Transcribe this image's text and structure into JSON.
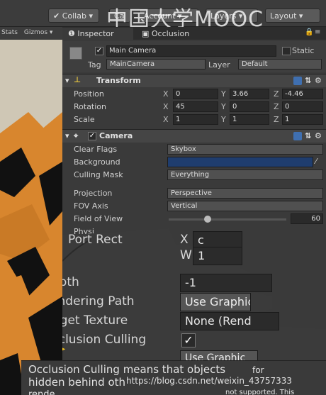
{
  "toolbar": {
    "collab": "Collab",
    "account": "Account",
    "layers": "Layers",
    "layout": "Layout",
    "cloud_label": "Ca",
    "watermark": "中国大学MOOC"
  },
  "scene": {
    "stats": "Stats",
    "gizmos": "Gizmos"
  },
  "tabs": {
    "inspector": "Inspector",
    "occlusion": "Occlusion"
  },
  "object": {
    "name": "Main Camera",
    "static_label": "Static",
    "tag_label": "Tag",
    "tag_value": "MainCamera",
    "layer_label": "Layer",
    "layer_value": "Default"
  },
  "transform": {
    "title": "Transform",
    "position_label": "Position",
    "position": {
      "x": "0",
      "y": "3.66",
      "z": "-4.46"
    },
    "rotation_label": "Rotation",
    "rotation": {
      "x": "45",
      "y": "0",
      "z": "0"
    },
    "scale_label": "Scale",
    "scale": {
      "x": "1",
      "y": "1",
      "z": "1"
    },
    "axis_x": "X",
    "axis_y": "Y",
    "axis_z": "Z"
  },
  "camera": {
    "title": "Camera",
    "clear_flags_label": "Clear Flags",
    "clear_flags_value": "Skybox",
    "background_label": "Background",
    "background_color": "#1f3d6e",
    "culling_mask_label": "Culling Mask",
    "culling_mask_value": "Everything",
    "projection_label": "Projection",
    "projection_value": "Perspective",
    "fov_axis_label": "FOV Axis",
    "fov_axis_value": "Vertical",
    "fov_label": "Field of View",
    "fov_value": "60",
    "fov_fraction": 0.32,
    "physical_label": "Physi"
  },
  "magnified": {
    "viewport_rect": "Port Rect",
    "x_label": "X",
    "x_value": "c",
    "w_label": "W",
    "w_value": "1",
    "depth_label": "Depth",
    "depth_value": "-1",
    "rendering_path_label": "Rendering Path",
    "rendering_path_value": "Use Graphic",
    "target_texture_label": "Target Texture",
    "target_texture_value": "None (Rend",
    "occlusion_culling_label": "Occlusion Culling",
    "occlusion_checked": "✓",
    "hdr_label": "HD",
    "hdr_value": "Use Graphic"
  },
  "tooltip": {
    "line1": "Occlusion Culling means that objects",
    "line2": "hidden behind oth",
    "line3": "rende",
    "right1": "for",
    "right2": "not supported. This"
  },
  "footer": {
    "csdn": "https://blog.csdn.net/weixin_43757333"
  },
  "colors": {
    "accent_blue": "#1f3d6e",
    "panel": "#3a3a3a",
    "scene_sky": "#cfc7b5",
    "cube_orange": "#d8862e"
  }
}
